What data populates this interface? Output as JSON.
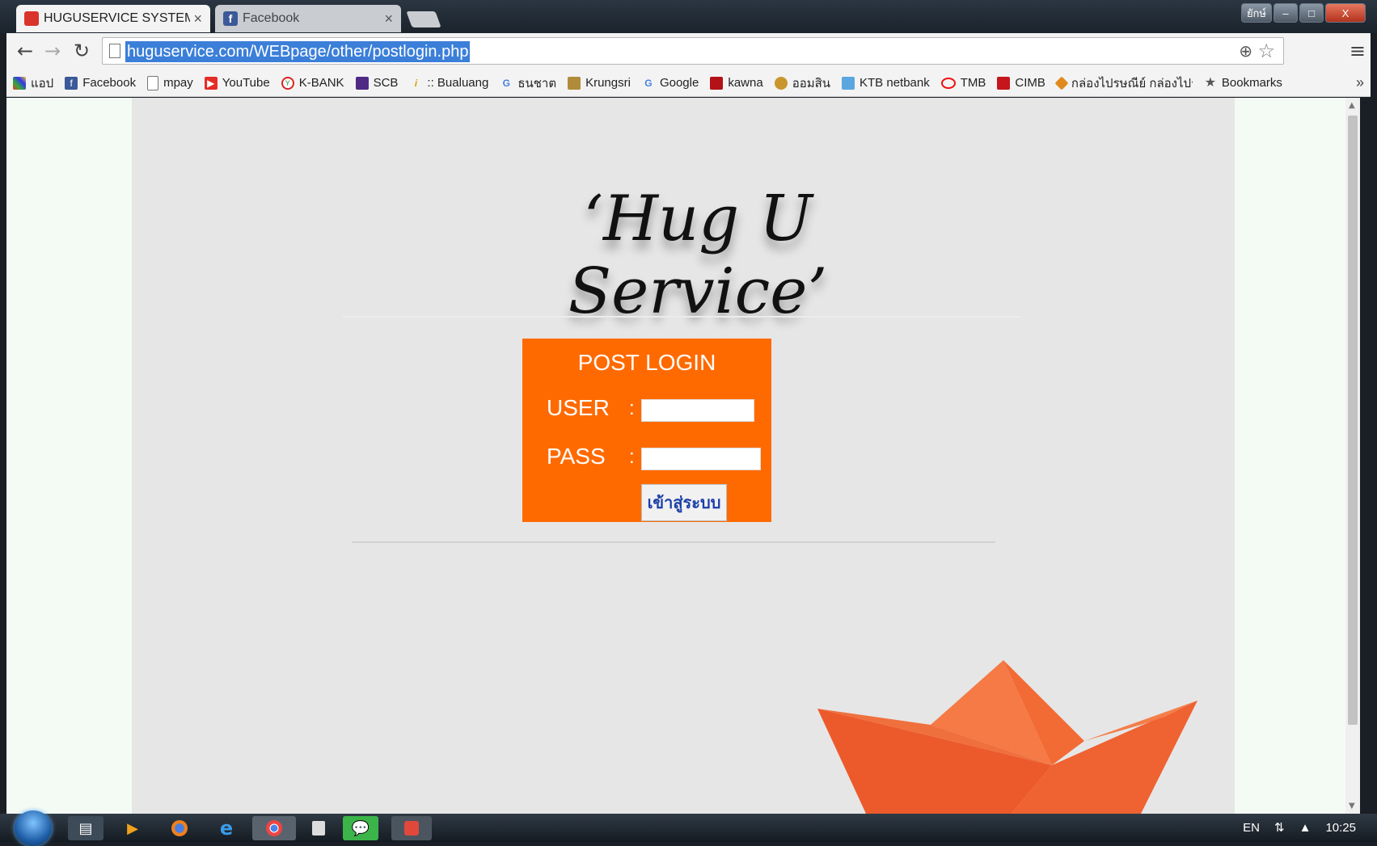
{
  "browser": {
    "tabs": [
      {
        "title": "HUGUSERVICE SYSTEM",
        "active": true
      },
      {
        "title": "Facebook",
        "active": false
      }
    ],
    "window_buttons": {
      "user": "ยักษ์",
      "minimize": "–",
      "maximize": "□",
      "close": "X"
    },
    "url": "huguservice.com/WEBpage/other/postlogin.php",
    "bookmarks": [
      {
        "label": "แอป",
        "icon": "apps-grid-icon"
      },
      {
        "label": "Facebook",
        "icon": "facebook-icon"
      },
      {
        "label": "mpay",
        "icon": "page-icon"
      },
      {
        "label": "YouTube",
        "icon": "youtube-icon"
      },
      {
        "label": "K-BANK",
        "icon": "kbank-icon"
      },
      {
        "label": "SCB",
        "icon": "scb-icon"
      },
      {
        "label": ":: Bualuang",
        "icon": "bualuang-icon"
      },
      {
        "label": "ธนชาต",
        "icon": "google-icon"
      },
      {
        "label": "Krungsri",
        "icon": "krungsri-icon"
      },
      {
        "label": "Google",
        "icon": "google-icon"
      },
      {
        "label": "kawna",
        "icon": "kawna-icon"
      },
      {
        "label": "ออมสิน",
        "icon": "gsb-icon"
      },
      {
        "label": "KTB netbank",
        "icon": "ktb-icon"
      },
      {
        "label": "TMB",
        "icon": "tmb-icon"
      },
      {
        "label": "CIMB",
        "icon": "cimb-icon"
      },
      {
        "label": "กล่องไปรษณีย์ กล่องไปรษ",
        "icon": "box-icon"
      },
      {
        "label": "Bookmarks",
        "icon": "star-icon"
      }
    ],
    "more_bookmarks": "»"
  },
  "page": {
    "logo": "‘Hug U Service’",
    "login": {
      "title": "POST LOGIN",
      "user_label": "USER",
      "pass_label": "PASS",
      "colon": ":",
      "submit_label": "เข้าสู่ระบบ"
    }
  },
  "taskbar": {
    "language": "EN",
    "time": "10:25"
  },
  "colors": {
    "login_box": "#ff6a00",
    "page_bg": "#e6e6e6",
    "boat": "#f0643a"
  }
}
